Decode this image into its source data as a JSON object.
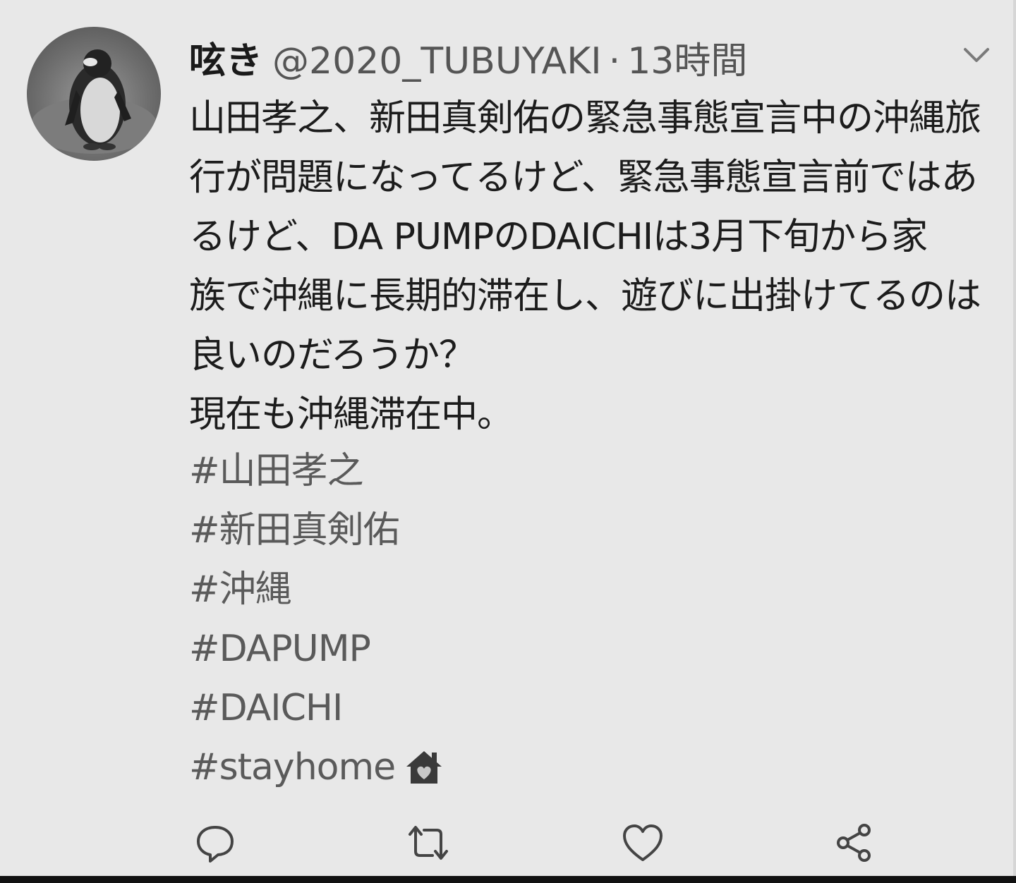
{
  "tweet": {
    "display_name": "呟き",
    "handle": "@2020_TUBUYAKI",
    "separator": "·",
    "time": "13時間",
    "lines": [
      "山田孝之、新田真剣佑の緊急事態宣言中の沖縄旅",
      "行が問題になってるけど、緊急事態宣言前ではあ",
      "るけど、DA PUMPのDAICHIは3月下旬から家",
      "族で沖縄に長期的滞在し、遊びに出掛けてるのは",
      "良いのだろうか？",
      "現在も沖縄滞在中。"
    ],
    "hashtags": [
      "#山田孝之",
      "#新田真剣佑",
      "#沖縄",
      "#DAPUMP",
      "#DAICHI",
      "#stayhome"
    ]
  },
  "icons": {
    "avatar": "penguin-avatar",
    "menu": "chevron-down-icon",
    "stayhome": "house-heart-icon",
    "reply": "reply-icon",
    "retweet": "retweet-icon",
    "like": "heart-icon",
    "share": "share-icon"
  }
}
